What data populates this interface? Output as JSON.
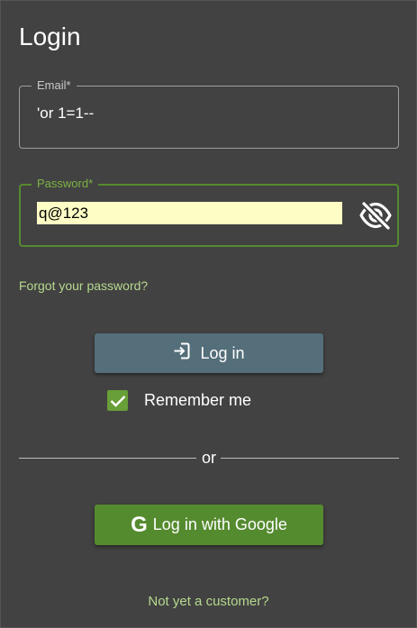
{
  "login": {
    "title": "Login",
    "email": {
      "label": "Email*",
      "value": "'or 1=1--"
    },
    "password": {
      "label": "Password*",
      "value": "q@123",
      "toggle_icon": "eye-off-icon"
    },
    "forgot_password": "Forgot your password?",
    "login_button": {
      "label": "Log in",
      "icon": "login-icon"
    },
    "remember_me": {
      "label": "Remember me",
      "checked": true
    },
    "divider_text": "or",
    "google_button": {
      "label": "Log in with Google",
      "icon": "google-icon"
    },
    "signup_link": "Not yet a customer?"
  },
  "colors": {
    "background": "#424242",
    "primary": "#546e7a",
    "accent": "#558b2f",
    "link": "#b5d98e",
    "autofill": "#fdfdc5"
  }
}
